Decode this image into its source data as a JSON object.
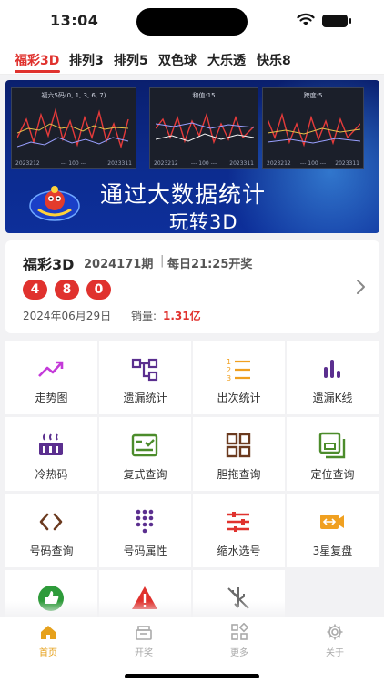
{
  "status_bar": {
    "time": "13:04"
  },
  "tabs": [
    {
      "label": "福彩3D",
      "active": true
    },
    {
      "label": "排列3"
    },
    {
      "label": "排列5"
    },
    {
      "label": "双色球"
    },
    {
      "label": "大乐透"
    },
    {
      "label": "快乐8"
    }
  ],
  "banner": {
    "line1": "通过大数据统计",
    "line2": "玩转3D",
    "charts": [
      {
        "title": "福六5码(0, 1, 3, 6, 7)",
        "x_start": "2023212",
        "x_mid": "--- 100 ---",
        "x_end": "2023311"
      },
      {
        "title": "和值:15",
        "x_start": "2023212",
        "x_mid": "--- 100 ---",
        "x_end": "2023311"
      },
      {
        "title": "跨度:5",
        "x_start": "2023212",
        "x_mid": "--- 100 ---",
        "x_end": "2023311"
      }
    ]
  },
  "info": {
    "name": "福彩3D",
    "issue": "2024171期",
    "separator": "|",
    "schedule": "每日21:25开奖",
    "balls": [
      "4",
      "8",
      "0"
    ],
    "date": "2024年06月29日",
    "sales_label": "销量:",
    "sales_value": "1.31亿"
  },
  "features": [
    {
      "label": "走势图",
      "icon": "trend-icon",
      "color": "#c43ad9"
    },
    {
      "label": "遗漏统计",
      "icon": "flow-icon",
      "color": "#5b2f8f"
    },
    {
      "label": "出次统计",
      "icon": "list-number-icon",
      "color": "#f0a020"
    },
    {
      "label": "遗漏K线",
      "icon": "bar-chart-icon",
      "color": "#5b2f8f"
    },
    {
      "label": "冷热码",
      "icon": "heat-icon",
      "color": "#5b2f8f"
    },
    {
      "label": "复式查询",
      "icon": "check-box-icon",
      "color": "#4c8c2b"
    },
    {
      "label": "胆拖查询",
      "icon": "grid-icon",
      "color": "#6b3a1f"
    },
    {
      "label": "定位查询",
      "icon": "layers-icon",
      "color": "#4c8c2b"
    },
    {
      "label": "号码查询",
      "icon": "code-arrows-icon",
      "color": "#6b3a1f"
    },
    {
      "label": "号码属性",
      "icon": "dots-grid-icon",
      "color": "#5b2f8f"
    },
    {
      "label": "缩水选号",
      "icon": "sliders-icon",
      "color": "#e0322e"
    },
    {
      "label": "3星复盘",
      "icon": "video-icon",
      "color": "#f0a020"
    },
    {
      "label": "",
      "icon": "thumb-up-icon",
      "color": "#2e9b3a"
    },
    {
      "label": "",
      "icon": "warning-icon",
      "color": "#e0322e"
    },
    {
      "label": "",
      "icon": "usb-off-icon",
      "color": "#6b6b6b"
    }
  ],
  "nav": [
    {
      "label": "首页",
      "icon": "home-icon",
      "active": true
    },
    {
      "label": "开奖",
      "icon": "gift-icon"
    },
    {
      "label": "更多",
      "icon": "apps-icon"
    },
    {
      "label": "关于",
      "icon": "gear-icon"
    }
  ]
}
